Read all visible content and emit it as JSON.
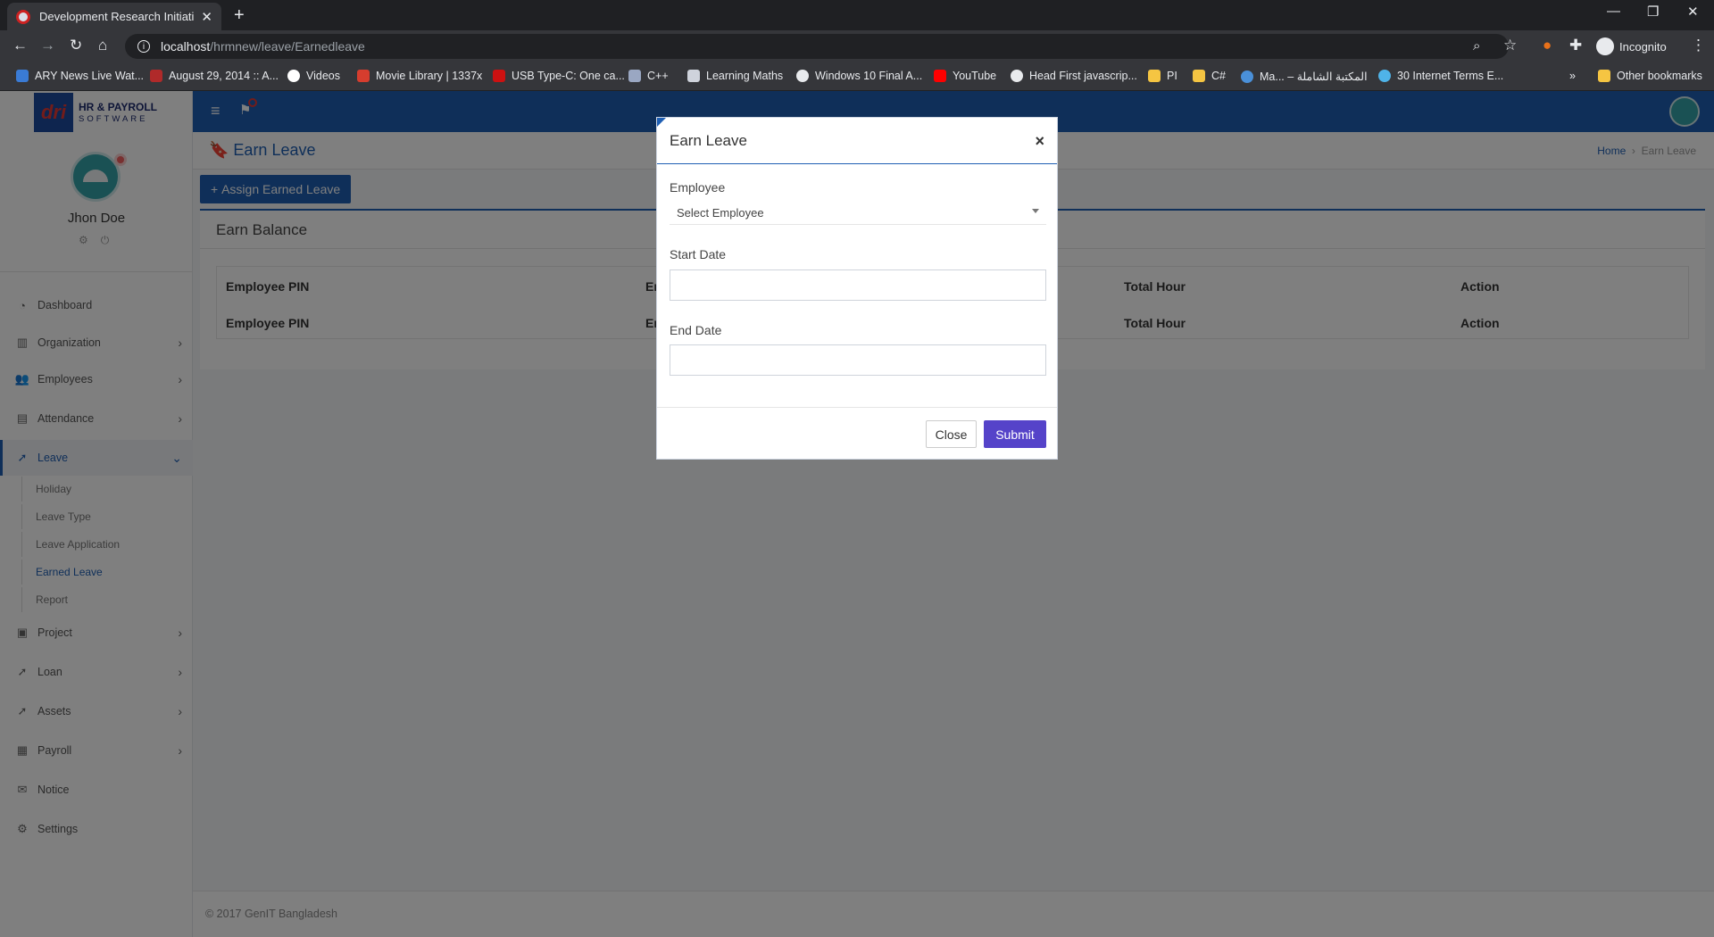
{
  "browser": {
    "tab_title": "Development Research Initiative",
    "url_host": "localhost",
    "url_path": "/hrmnew/leave/Earnedleave",
    "incognito_label": "Incognito",
    "bookmarks": [
      "ARY News Live Wat...",
      "August 29, 2014 :: A...",
      "Videos",
      "Movie Library | 1337x",
      "USB Type-C: One ca...",
      "C++",
      "Learning Maths",
      "Windows 10 Final A...",
      "YouTube",
      "Head First javascrip...",
      "PI",
      "C#",
      "Ma... – المكتبة الشاملة",
      "30 Internet Terms E...",
      "Other bookmarks"
    ]
  },
  "app": {
    "logo_line1": "HR & PAYROLL",
    "logo_line2": "SOFTWARE",
    "logo_mark": "dri",
    "user_name": "Jhon Doe",
    "menu": [
      {
        "label": "Dashboard",
        "icon": "dashboard-icon"
      },
      {
        "label": "Organization",
        "icon": "building-icon"
      },
      {
        "label": "Employees",
        "icon": "users-icon"
      },
      {
        "label": "Attendance",
        "icon": "clipboard-icon"
      },
      {
        "label": "Leave",
        "icon": "rocket-icon"
      },
      {
        "label": "Project",
        "icon": "briefcase-icon"
      },
      {
        "label": "Loan",
        "icon": "rocket-icon"
      },
      {
        "label": "Assets",
        "icon": "rocket-icon"
      },
      {
        "label": "Payroll",
        "icon": "table-icon"
      },
      {
        "label": "Notice",
        "icon": "mail-icon"
      },
      {
        "label": "Settings",
        "icon": "gear-icon"
      }
    ],
    "leave_submenu": [
      "Holiday",
      "Leave Type",
      "Leave Application",
      "Earned Leave",
      "Report"
    ],
    "page_title": "Earn Leave",
    "breadcrumb": {
      "home": "Home",
      "current": "Earn Leave"
    },
    "assign_button": "Assign Earned Leave",
    "card_title": "Earn Balance",
    "table_headers": [
      "Employee PIN",
      "Er",
      "Total Hour",
      "Action"
    ],
    "footer": "© 2017 GenIT Bangladesh"
  },
  "modal": {
    "title": "Earn Leave",
    "employee_label": "Employee",
    "employee_select": "Select Employee",
    "start_label": "Start Date",
    "start_value": "",
    "end_label": "End Date",
    "end_value": "",
    "close_label": "Close",
    "submit_label": "Submit"
  },
  "colors": {
    "primary": "#1f5fb3",
    "submit": "#5543c9"
  }
}
